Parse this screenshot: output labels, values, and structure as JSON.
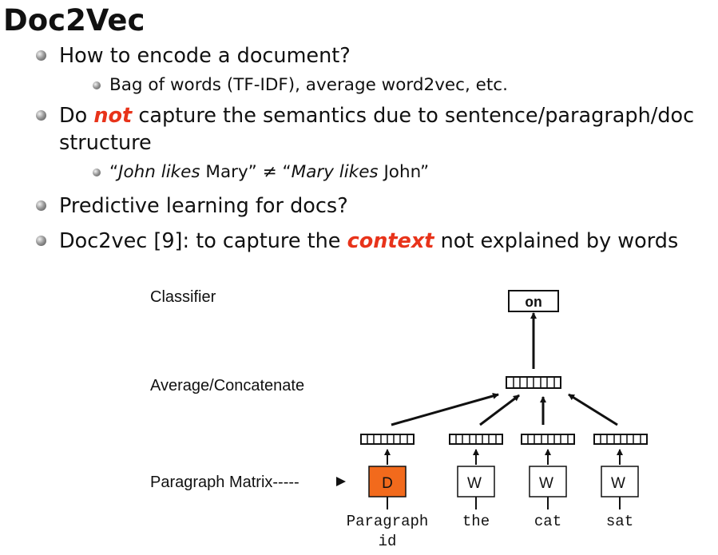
{
  "title": "Doc2Vec",
  "bullets": {
    "b1": "How to encode a document?",
    "b1_sub": "Bag of words (TF-IDF), average word2vec, etc.",
    "b2_pre": "Do ",
    "b2_em": "not",
    "b2_post": " capture the semantics due to sentence/paragraph/doc",
    "b2_cont": "structure",
    "b2_sub": {
      "q1": "“",
      "p1": "John likes",
      "p2": " Mary” ",
      "neq": "≠",
      "q2": " “",
      "p3": "Mary likes",
      "p4": " John”"
    },
    "b3": "Predictive learning for docs?",
    "b4_pre": "Doc2vec [9]:  to capture the ",
    "b4_em": "context",
    "b4_post": " not explained by words"
  },
  "diagram": {
    "label_classifier": "Classifier",
    "label_average": "Average/Concatenate",
    "label_paragraph_matrix": "Paragraph Matrix-----",
    "output_word": "on",
    "doc_box": "D",
    "word_box": "W",
    "inputs": [
      "Paragraph",
      "id",
      "the",
      "cat",
      "sat"
    ],
    "doc_color": "#f26a1c"
  }
}
